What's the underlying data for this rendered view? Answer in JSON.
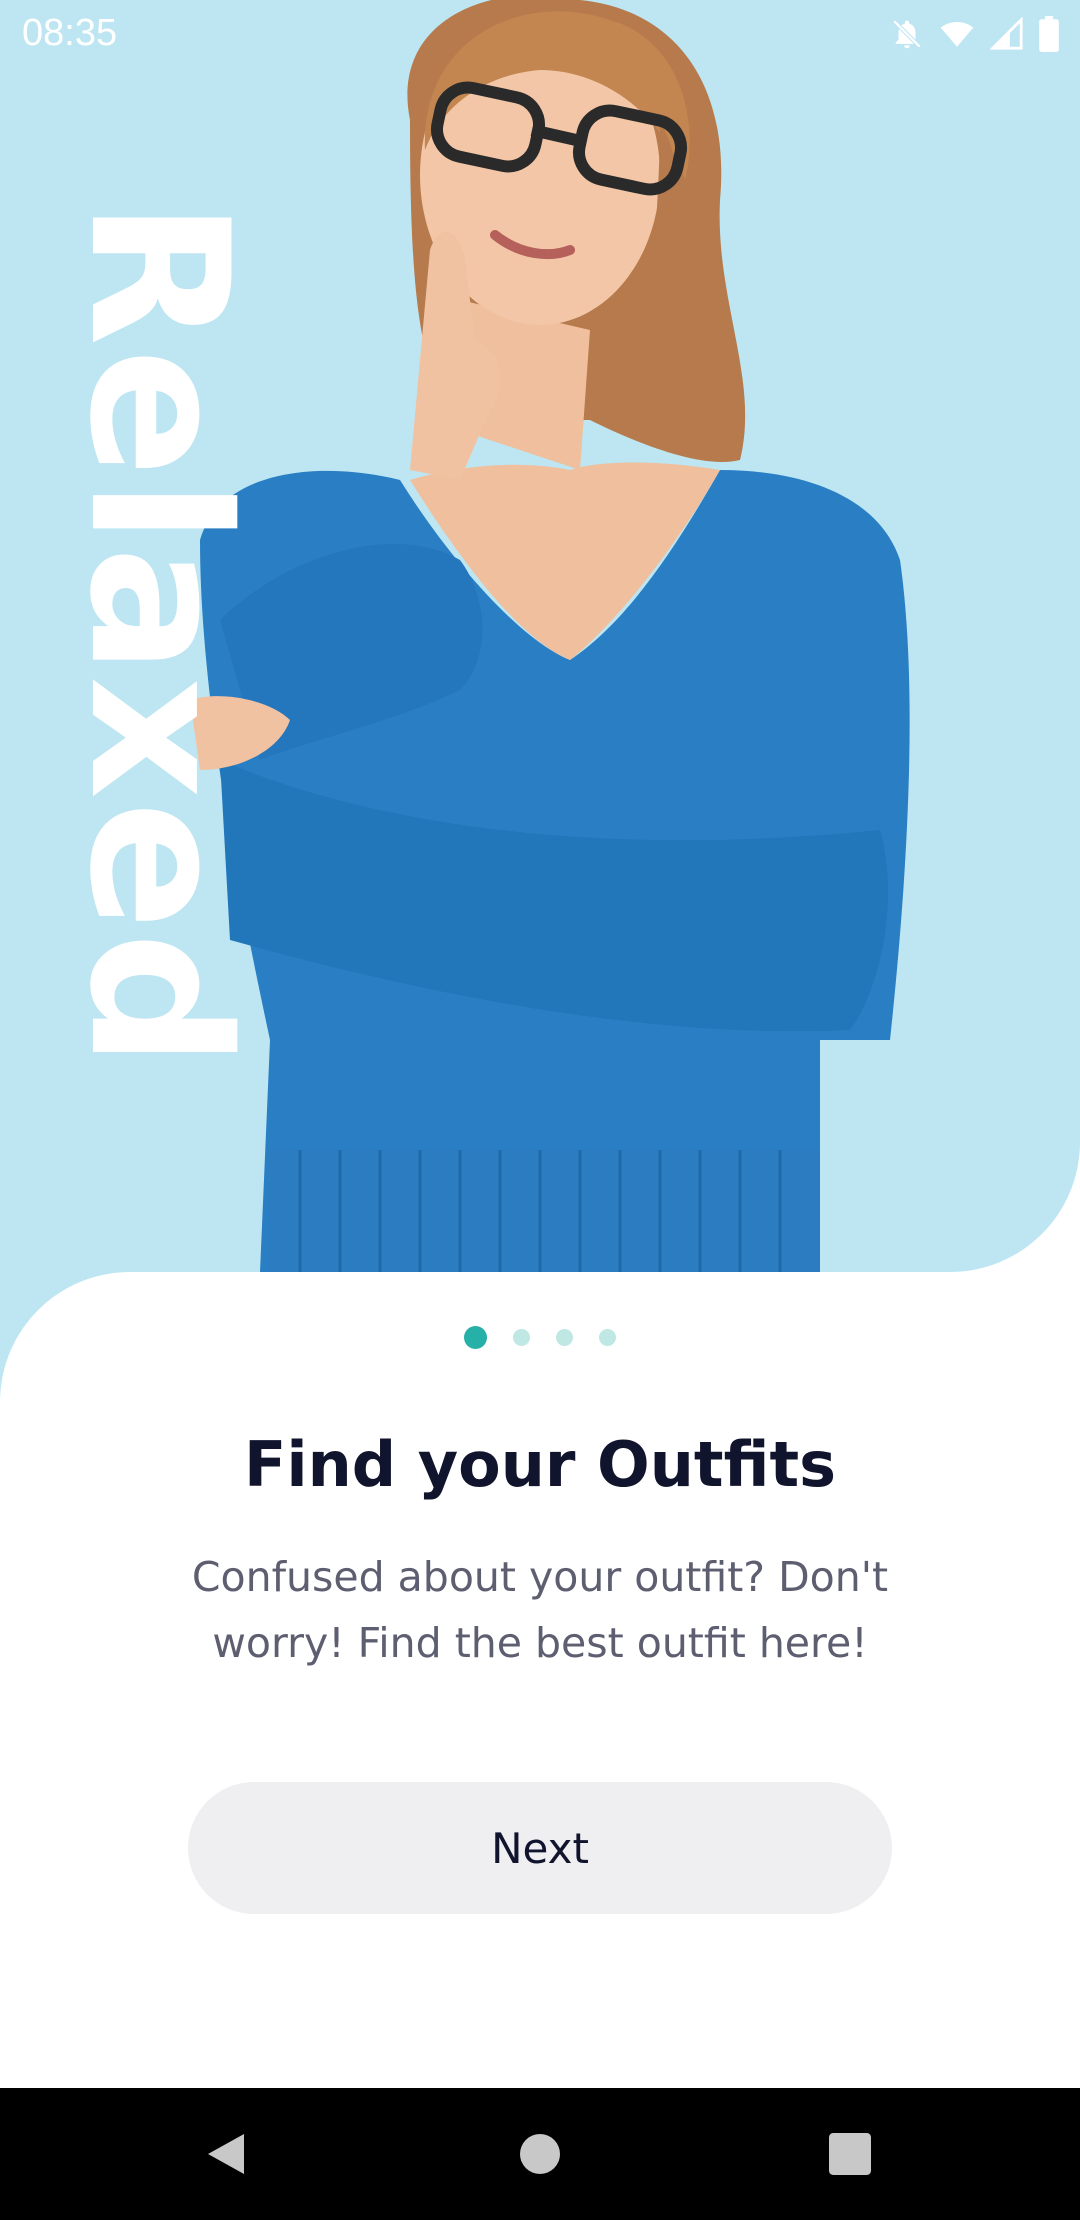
{
  "status_bar": {
    "time": "08:35",
    "icons": [
      "notifications-off-icon",
      "wifi-icon",
      "signal-icon",
      "battery-icon"
    ]
  },
  "slide": {
    "vertical_word": "Relaxed",
    "image": "woman-thinking-photo",
    "background_color": "#bde6f2"
  },
  "pager": {
    "total": 4,
    "active_index": 0,
    "active_color": "#26b0a8",
    "inactive_color": "#bfe7e4"
  },
  "content": {
    "title": "Find your Outfits",
    "description": "Confused about your outfit? Don't worry! Find the best outfit here!"
  },
  "actions": {
    "next_label": "Next"
  },
  "nav_bar": {
    "buttons": [
      "back-icon",
      "home-icon",
      "recents-icon"
    ]
  }
}
